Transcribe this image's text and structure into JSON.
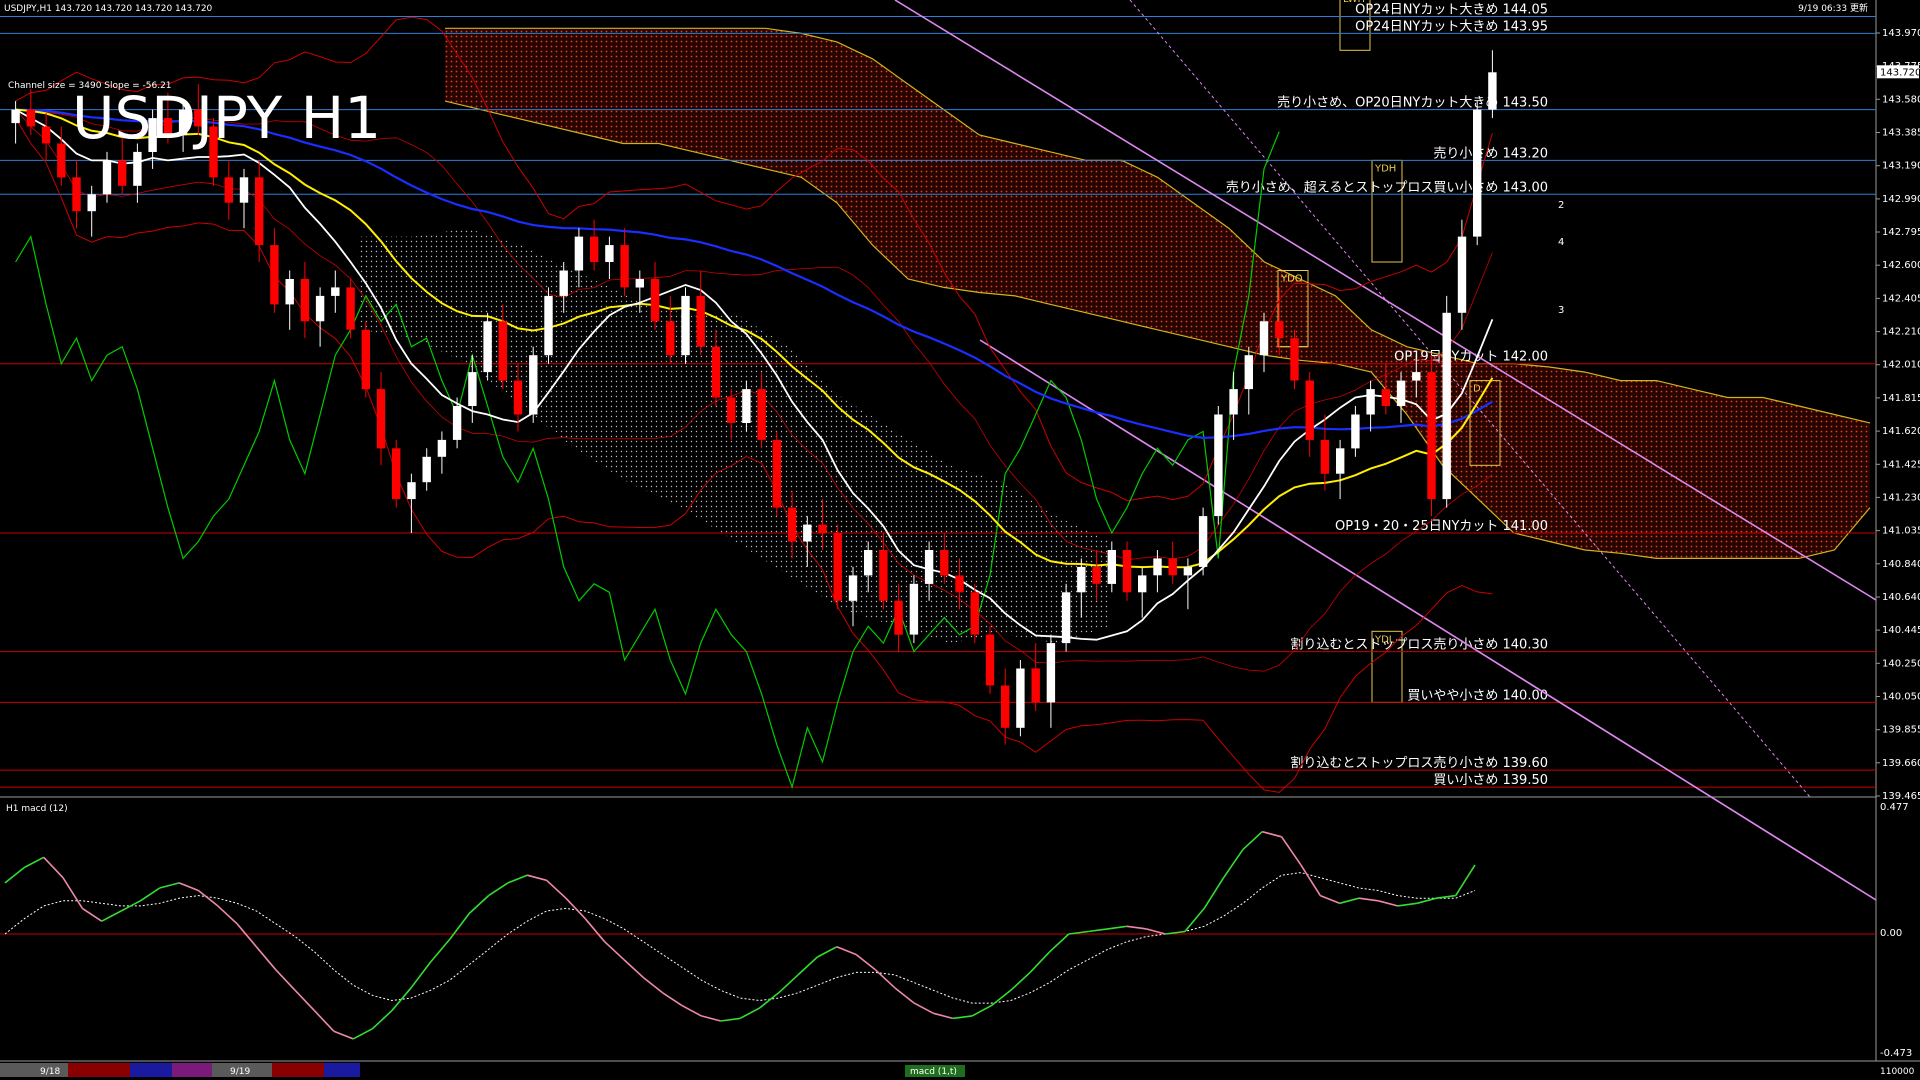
{
  "header": {
    "symbol_line": "USDJPY,H1  143.720 143.720 143.720 143.720",
    "date_text": "9/19 06:33 更新",
    "channel_text": "Channel size = 3490 Slope = -56.21",
    "big_title": "USDJPY H1"
  },
  "subwindow": {
    "label": "H1  macd (12)",
    "axis_top": "0.477",
    "axis_zero": "0.00",
    "axis_bottom": "-0.473",
    "tab_label": "macd (1,t)"
  },
  "bottom_bar": {
    "date1": "9/18",
    "date2": "9/19",
    "right_value": "110000"
  },
  "colors": {
    "bull": "#ffffff",
    "bear": "#ff0000",
    "sma_white": "#ffffff",
    "sma_yellow": "#ffee00",
    "sma_blue": "#1a2fff",
    "cloud": "#ff4422",
    "bollinger": "#cc0000",
    "chikou": "#00cc00",
    "level_red": "#cc0000",
    "level_blue": "#2e7fd8",
    "channel": "#dd88ee",
    "macd_up": "#33dd33",
    "macd_down": "#ee88aa",
    "pivot": "#e6c84a"
  },
  "chart_data": {
    "type": "candlestick",
    "title": "USDJPY H1",
    "ylim": [
      139.465,
      143.97
    ],
    "y_ticks": [
      "143.970",
      "143.775",
      "143.580",
      "143.385",
      "143.190",
      "142.990",
      "142.795",
      "142.600",
      "142.405",
      "142.210",
      "142.010",
      "141.815",
      "141.620",
      "141.425",
      "141.230",
      "141.035",
      "140.840",
      "140.640",
      "140.445",
      "140.250",
      "140.050",
      "139.855",
      "139.660",
      "139.465"
    ],
    "current_price": "143.720",
    "level_lines": [
      {
        "price": 144.05,
        "text": "OP24日NYカット大きめ 144.05",
        "color": "blue"
      },
      {
        "price": 143.95,
        "text": "OP24日NYカット大きめ 143.95",
        "color": "blue"
      },
      {
        "price": 143.5,
        "text": "売り小さめ、OP20日NYカット大きめ 143.50",
        "color": "blue"
      },
      {
        "price": 143.2,
        "text": "売り小さめ 143.20",
        "color": "blue"
      },
      {
        "price": 143.0,
        "text": "売り小さめ、超えるとストップロス買い小さめ 143.00",
        "color": "blue"
      },
      {
        "price": 142.0,
        "text": "OP19日NYカット 142.00",
        "color": "red"
      },
      {
        "price": 141.0,
        "text": "OP19・20・25日NYカット 141.00",
        "color": "red"
      },
      {
        "price": 140.3,
        "text": "割り込むとストップロス売り小さめ 140.30",
        "color": "red"
      },
      {
        "price": 140.0,
        "text": "買いやや小さめ 140.00",
        "color": "red"
      },
      {
        "price": 139.6,
        "text": "割り込むとストップロス売り小さめ 139.60",
        "color": "red"
      },
      {
        "price": 139.5,
        "text": "買い小さめ 139.50",
        "color": "red"
      }
    ],
    "pivot_boxes": [
      "LWH",
      "YDH",
      "YDO",
      "YDC",
      "YDL",
      "D"
    ],
    "wave_labels": [
      "2",
      "3",
      "4"
    ],
    "candles": [
      [
        143.42,
        143.55,
        143.3,
        143.5
      ],
      [
        143.5,
        143.62,
        143.35,
        143.4
      ],
      [
        143.4,
        143.48,
        143.2,
        143.3
      ],
      [
        143.3,
        143.4,
        143.05,
        143.1
      ],
      [
        143.1,
        143.2,
        142.8,
        142.9
      ],
      [
        142.9,
        143.05,
        142.75,
        143.0
      ],
      [
        143.0,
        143.25,
        142.95,
        143.2
      ],
      [
        143.2,
        143.35,
        143.0,
        143.05
      ],
      [
        143.05,
        143.3,
        142.95,
        143.25
      ],
      [
        143.25,
        143.5,
        143.15,
        143.45
      ],
      [
        143.45,
        143.6,
        143.3,
        143.35
      ],
      [
        143.35,
        143.55,
        143.25,
        143.5
      ],
      [
        143.5,
        143.65,
        143.35,
        143.4
      ],
      [
        143.4,
        143.45,
        143.05,
        143.1
      ],
      [
        143.1,
        143.2,
        142.85,
        142.95
      ],
      [
        142.95,
        143.15,
        142.8,
        143.1
      ],
      [
        143.1,
        143.2,
        142.6,
        142.7
      ],
      [
        142.7,
        142.8,
        142.3,
        142.35
      ],
      [
        142.35,
        142.55,
        142.2,
        142.5
      ],
      [
        142.5,
        142.6,
        142.15,
        142.25
      ],
      [
        142.25,
        142.45,
        142.1,
        142.4
      ],
      [
        142.4,
        142.55,
        142.3,
        142.45
      ],
      [
        142.45,
        142.5,
        142.15,
        142.2
      ],
      [
        142.2,
        142.25,
        141.8,
        141.85
      ],
      [
        141.85,
        141.95,
        141.4,
        141.5
      ],
      [
        141.5,
        141.55,
        141.15,
        141.2
      ],
      [
        141.2,
        141.35,
        141.0,
        141.3
      ],
      [
        141.3,
        141.5,
        141.25,
        141.45
      ],
      [
        141.45,
        141.6,
        141.35,
        141.55
      ],
      [
        141.55,
        141.8,
        141.5,
        141.75
      ],
      [
        141.75,
        142.05,
        141.65,
        141.95
      ],
      [
        141.95,
        142.3,
        141.9,
        142.25
      ],
      [
        142.25,
        142.35,
        141.85,
        141.9
      ],
      [
        141.9,
        142.0,
        141.6,
        141.7
      ],
      [
        141.7,
        142.1,
        141.65,
        142.05
      ],
      [
        142.05,
        142.45,
        142.0,
        142.4
      ],
      [
        142.4,
        142.6,
        142.3,
        142.55
      ],
      [
        142.55,
        142.8,
        142.45,
        142.75
      ],
      [
        142.75,
        142.85,
        142.55,
        142.6
      ],
      [
        142.6,
        142.75,
        142.5,
        142.7
      ],
      [
        142.7,
        142.8,
        142.4,
        142.45
      ],
      [
        142.45,
        142.55,
        142.3,
        142.5
      ],
      [
        142.5,
        142.6,
        142.2,
        142.25
      ],
      [
        142.25,
        142.4,
        142.0,
        142.05
      ],
      [
        142.05,
        142.45,
        142.0,
        142.4
      ],
      [
        142.4,
        142.55,
        142.05,
        142.1
      ],
      [
        142.1,
        142.2,
        141.75,
        141.8
      ],
      [
        141.8,
        141.85,
        141.55,
        141.65
      ],
      [
        141.65,
        141.9,
        141.6,
        141.85
      ],
      [
        141.85,
        141.95,
        141.5,
        141.55
      ],
      [
        141.55,
        141.6,
        141.1,
        141.15
      ],
      [
        141.15,
        141.25,
        140.85,
        140.95
      ],
      [
        140.95,
        141.1,
        140.8,
        141.05
      ],
      [
        141.05,
        141.2,
        140.9,
        141.0
      ],
      [
        141.0,
        141.05,
        140.55,
        140.6
      ],
      [
        140.6,
        140.8,
        140.45,
        140.75
      ],
      [
        140.75,
        140.95,
        140.65,
        140.9
      ],
      [
        140.9,
        141.0,
        140.55,
        140.6
      ],
      [
        140.6,
        140.7,
        140.3,
        140.4
      ],
      [
        140.4,
        140.75,
        140.35,
        140.7
      ],
      [
        140.7,
        140.95,
        140.6,
        140.9
      ],
      [
        140.9,
        141.0,
        140.7,
        140.75
      ],
      [
        140.75,
        140.85,
        140.55,
        140.65
      ],
      [
        140.65,
        140.7,
        140.35,
        140.4
      ],
      [
        140.4,
        140.45,
        140.05,
        140.1
      ],
      [
        140.1,
        140.2,
        139.75,
        139.85
      ],
      [
        139.85,
        140.25,
        139.8,
        140.2
      ],
      [
        140.2,
        140.35,
        139.95,
        140.0
      ],
      [
        140.0,
        140.4,
        139.85,
        140.35
      ],
      [
        140.35,
        140.7,
        140.3,
        140.65
      ],
      [
        140.65,
        140.85,
        140.5,
        140.8
      ],
      [
        140.8,
        140.9,
        140.6,
        140.7
      ],
      [
        140.7,
        140.95,
        140.65,
        140.9
      ],
      [
        140.9,
        140.95,
        140.6,
        140.65
      ],
      [
        140.65,
        140.8,
        140.5,
        140.75
      ],
      [
        140.75,
        140.9,
        140.65,
        140.85
      ],
      [
        140.85,
        140.95,
        140.7,
        140.75
      ],
      [
        140.75,
        140.85,
        140.55,
        140.8
      ],
      [
        140.8,
        141.15,
        140.75,
        141.1
      ],
      [
        141.1,
        141.75,
        141.05,
        141.7
      ],
      [
        141.7,
        141.95,
        141.55,
        141.85
      ],
      [
        141.85,
        142.1,
        141.7,
        142.05
      ],
      [
        142.05,
        142.3,
        141.95,
        142.25
      ],
      [
        142.25,
        142.45,
        142.05,
        142.15
      ],
      [
        142.15,
        142.2,
        141.85,
        141.9
      ],
      [
        141.9,
        141.95,
        141.45,
        141.55
      ],
      [
        141.55,
        141.7,
        141.25,
        141.35
      ],
      [
        141.35,
        141.55,
        141.2,
        141.5
      ],
      [
        141.5,
        141.75,
        141.45,
        141.7
      ],
      [
        141.7,
        141.9,
        141.6,
        141.85
      ],
      [
        141.85,
        142.0,
        141.7,
        141.75
      ],
      [
        141.75,
        141.95,
        141.65,
        141.9
      ],
      [
        141.9,
        142.05,
        141.8,
        141.95
      ],
      [
        141.95,
        142.05,
        141.1,
        141.2
      ],
      [
        141.2,
        142.4,
        141.15,
        142.3
      ],
      [
        142.3,
        142.85,
        142.2,
        142.75
      ],
      [
        142.75,
        143.55,
        142.7,
        143.5
      ],
      [
        143.5,
        143.85,
        143.45,
        143.72
      ]
    ],
    "macd": [
      0.2,
      0.26,
      0.3,
      0.22,
      0.1,
      0.05,
      0.09,
      0.13,
      0.18,
      0.2,
      0.17,
      0.11,
      0.04,
      -0.05,
      -0.14,
      -0.22,
      -0.3,
      -0.38,
      -0.41,
      -0.37,
      -0.3,
      -0.21,
      -0.11,
      -0.02,
      0.08,
      0.15,
      0.2,
      0.23,
      0.21,
      0.14,
      0.06,
      -0.03,
      -0.1,
      -0.17,
      -0.23,
      -0.28,
      -0.32,
      -0.34,
      -0.33,
      -0.29,
      -0.23,
      -0.16,
      -0.09,
      -0.05,
      -0.08,
      -0.14,
      -0.21,
      -0.27,
      -0.31,
      -0.33,
      -0.32,
      -0.28,
      -0.22,
      -0.15,
      -0.07,
      0.0,
      0.01,
      0.02,
      0.03,
      0.02,
      0.0,
      0.01,
      0.1,
      0.22,
      0.33,
      0.4,
      0.38,
      0.27,
      0.15,
      0.12,
      0.14,
      0.13,
      0.11,
      0.12,
      0.14,
      0.15,
      0.27
    ],
    "macd_signal": [
      0.0,
      0.06,
      0.11,
      0.13,
      0.13,
      0.12,
      0.11,
      0.11,
      0.12,
      0.14,
      0.15,
      0.14,
      0.12,
      0.09,
      0.04,
      -0.01,
      -0.07,
      -0.14,
      -0.2,
      -0.24,
      -0.26,
      -0.25,
      -0.22,
      -0.18,
      -0.12,
      -0.06,
      0.0,
      0.05,
      0.09,
      0.1,
      0.09,
      0.06,
      0.02,
      -0.03,
      -0.08,
      -0.13,
      -0.18,
      -0.22,
      -0.25,
      -0.26,
      -0.25,
      -0.23,
      -0.2,
      -0.17,
      -0.15,
      -0.15,
      -0.16,
      -0.19,
      -0.22,
      -0.25,
      -0.27,
      -0.27,
      -0.26,
      -0.23,
      -0.19,
      -0.14,
      -0.1,
      -0.06,
      -0.03,
      -0.01,
      0.0,
      0.01,
      0.03,
      0.07,
      0.12,
      0.18,
      0.23,
      0.24,
      0.22,
      0.2,
      0.18,
      0.17,
      0.15,
      0.14,
      0.14,
      0.14,
      0.17
    ]
  }
}
